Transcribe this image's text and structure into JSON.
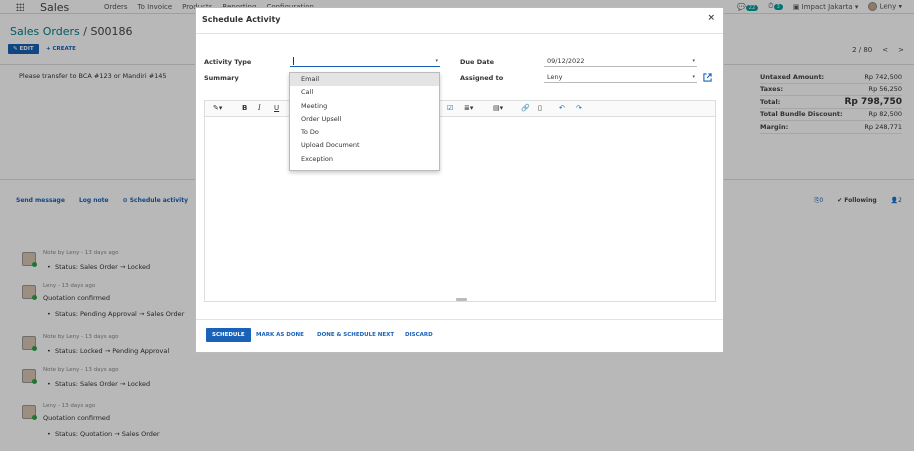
{
  "topbar": {
    "app_name": "Sales",
    "menu": [
      "Orders",
      "To Invoice",
      "Products",
      "Reporting",
      "Configuration"
    ],
    "chat_badge": "22",
    "activity_badge": "3",
    "company": "Impact Jakarta",
    "user": "Leny"
  },
  "breadcrumb": {
    "parent": "Sales Orders",
    "sep": "/",
    "current": "S00186"
  },
  "actions": {
    "edit": "EDIT",
    "create": "+ CREATE"
  },
  "pager": {
    "text": "2 / 80",
    "prev": "<",
    "next": ">"
  },
  "sheet": {
    "note": "Please transfer to BCA #123 or Mandiri #145",
    "totals": [
      {
        "label": "Untaxed Amount:",
        "value": "Rp 742,500"
      },
      {
        "label": "Taxes:",
        "value": "Rp 56,250"
      },
      {
        "label": "Total:",
        "value": "Rp 798,750"
      },
      {
        "label": "Total Bundle Discount:",
        "value": "Rp 82,500"
      },
      {
        "label": "Margin:",
        "value": "Rp 248,771"
      }
    ]
  },
  "chatter": {
    "send_message": "Send message",
    "log_note": "Log note",
    "schedule_activity": "⊙ Schedule activity",
    "attachments": "0",
    "following": "✔ Following",
    "followers": "2",
    "messages": [
      {
        "head": "Note by Leny - 13 days ago",
        "body": "",
        "bullet": "Status: Sales Order → Locked"
      },
      {
        "head": "Leny - 13 days ago",
        "body": "Quotation confirmed",
        "bullet": "Status: Pending Approval → Sales Order"
      },
      {
        "head": "Note by Leny - 13 days ago",
        "body": "",
        "bullet": "Status: Locked → Pending Approval"
      },
      {
        "head": "Note by Leny - 13 days ago",
        "body": "",
        "bullet": "Status: Sales Order → Locked"
      },
      {
        "head": "Leny - 13 days ago",
        "body": "Quotation confirmed",
        "bullet": "Status: Quotation → Sales Order"
      }
    ]
  },
  "modal": {
    "title": "Schedule Activity",
    "close": "×",
    "activity_type_label": "Activity Type",
    "activity_type_value": "",
    "summary_label": "Summary",
    "due_date_label": "Due Date",
    "due_date_value": "09/12/2022",
    "assigned_to_label": "Assigned to",
    "assigned_to_value": "Leny",
    "footer": {
      "schedule": "SCHEDULE",
      "mark_done": "MARK AS DONE",
      "done_next": "DONE & SCHEDULE NEXT",
      "discard": "DISCARD"
    }
  },
  "dropdown": {
    "options": [
      "Email",
      "Call",
      "Meeting",
      "Order Upsell",
      "To Do",
      "Upload Document",
      "Exception"
    ],
    "highlighted": 0
  },
  "colors": {
    "primary": "#1862b8",
    "brand": "#017e84",
    "online": "#28a745"
  }
}
